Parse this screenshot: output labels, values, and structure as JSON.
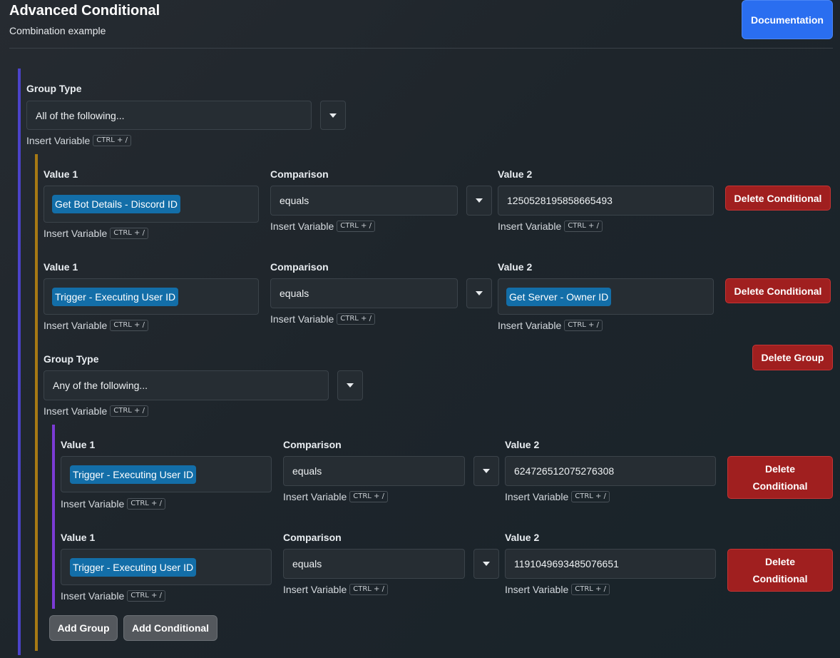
{
  "header": {
    "title": "Advanced Conditional",
    "subtitle": "Combination example",
    "documentation_button": "Documentation"
  },
  "common": {
    "insert_variable": "Insert Variable",
    "shortcut": "CTRL + /",
    "value1_label": "Value 1",
    "comparison_label": "Comparison",
    "value2_label": "Value 2",
    "group_type_label": "Group Type",
    "delete_conditional": "Delete Conditional",
    "delete_group": "Delete Group"
  },
  "root_group": {
    "group_type": "All of the following..."
  },
  "conditionals": [
    {
      "value1_chip": "Get Bot Details - Discord ID",
      "comparison": "equals",
      "value2": "1250528195858665493"
    },
    {
      "value1_chip": "Trigger - Executing User ID",
      "comparison": "equals",
      "value2_chip": "Get Server - Owner ID"
    }
  ],
  "nested_group": {
    "group_type": "Any of the following...",
    "conditionals": [
      {
        "value1_chip": "Trigger - Executing User ID",
        "comparison": "equals",
        "value2": "624726512075276308"
      },
      {
        "value1_chip": "Trigger - Executing User ID",
        "comparison": "equals",
        "value2": "1191049693485076651"
      }
    ]
  },
  "actions": {
    "add_group": "Add Group",
    "add_conditional": "Add Conditional"
  },
  "colors": {
    "root_bar": "#4b43c9",
    "group_bar": "#a77914",
    "nested_bar": "#7c3bd6",
    "chip": "#136ea8",
    "primary": "#2a6ef0",
    "danger": "#a01f1f"
  }
}
